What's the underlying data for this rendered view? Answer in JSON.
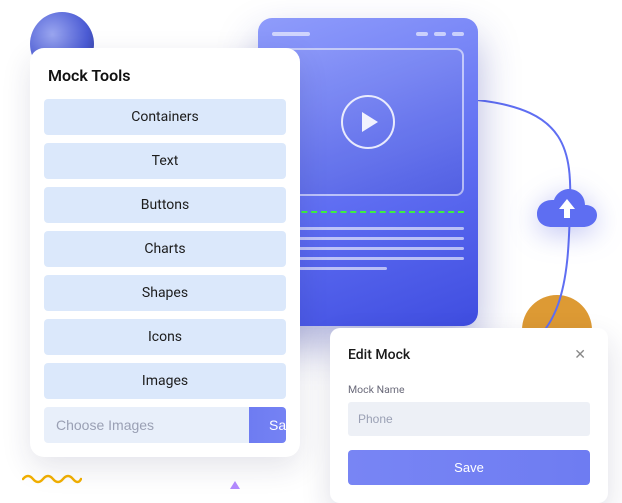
{
  "tools_panel": {
    "title": "Mock Tools",
    "items": [
      {
        "label": "Containers"
      },
      {
        "label": "Text"
      },
      {
        "label": "Buttons"
      },
      {
        "label": "Charts"
      },
      {
        "label": "Shapes"
      },
      {
        "label": "Icons"
      },
      {
        "label": "Images"
      }
    ],
    "choose_placeholder": "Choose Images",
    "save_label": "Save"
  },
  "edit_panel": {
    "title": "Edit Mock",
    "field_label": "Mock Name",
    "input_placeholder": "Phone",
    "save_label": "Save"
  },
  "colors": {
    "accent_gradient_from": "#8f9cfb",
    "accent_gradient_to": "#3f4de0",
    "tool_item_bg": "#dbe8fb"
  }
}
